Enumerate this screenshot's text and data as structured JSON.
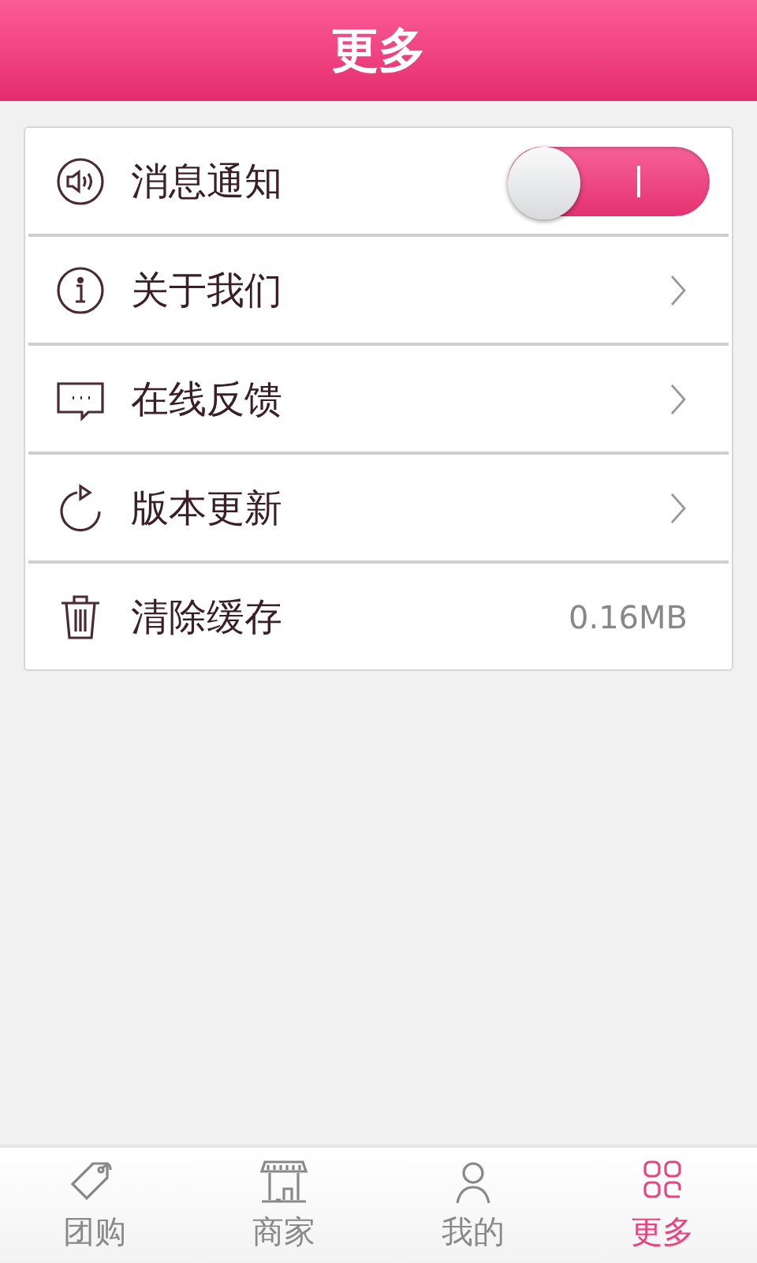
{
  "header": {
    "title": "更多"
  },
  "settings": [
    {
      "kind": "toggle",
      "label": "消息通知",
      "on": true
    },
    {
      "kind": "link",
      "label": "关于我们"
    },
    {
      "kind": "link",
      "label": "在线反馈"
    },
    {
      "kind": "link",
      "label": "版本更新"
    },
    {
      "kind": "value",
      "label": "清除缓存",
      "value": "0.16MB"
    }
  ],
  "tabs": [
    {
      "label": "团购",
      "selected": false
    },
    {
      "label": "商家",
      "selected": false
    },
    {
      "label": "我的",
      "selected": false
    },
    {
      "label": "更多",
      "selected": true
    }
  ]
}
